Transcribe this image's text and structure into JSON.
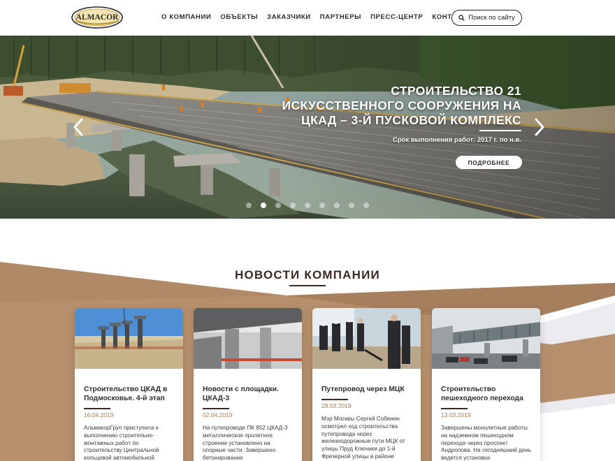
{
  "header": {
    "logo_text": "ALMACOR",
    "nav": [
      "О КОМПАНИИ",
      "ОБЪЕКТЫ",
      "ЗАКАЗЧИКИ",
      "ПАРТНЕРЫ",
      "ПРЕСС-ЦЕНТР",
      "КОНТАКТЫ"
    ],
    "search_label": "Поиск по сайту",
    "search_icon": "search-icon"
  },
  "hero": {
    "title": "СТРОИТЕЛЬСТВО 21 ИСКУССТВЕННОГО СООРУЖЕНИЯ НА ЦКАД – 3-Й ПУСКОВОЙ КОМПЛЕКС",
    "subtitle": "Срок выполнения работ: 2017 г. по н.в.",
    "more_label": "ПОДРОБНЕЕ",
    "slide_count": 9,
    "active_slide": 2
  },
  "news": {
    "title": "НОВОСТИ КОМПАНИИ",
    "items": [
      {
        "title": "Строительство ЦКАД в Подмосковье. 4-й этап",
        "date": "16.04.2019",
        "text": "АльмакорГруп приступила к выполнению строительно-монтажных работ по строительству Центральной кольцевой автомобильной"
      },
      {
        "title": "Новости с площадки. ЦКАД-3",
        "date": "02.04.2019",
        "text": "На путепроводе ПК 852 ЦКАД-3 металлическое пролетное строение установлено на опорные части. Завершено бетонирование"
      },
      {
        "title": "Путепровод через МЦК",
        "date": "28.03.2019",
        "text": "Мэр Москвы Сергей Собянин осмотрел ход строительства путепровода через железнодорожные пути МЦК от улицы Пруд Ключики до 1-й Фрезерной улицы в районе"
      },
      {
        "title": "Строительство пешеходного перехода",
        "date": "13.03.2019",
        "text": "Завершены монолитные работы на надземном пешеходном переходе через проспект Андропова. На сегодняшний день ведется установка"
      }
    ]
  },
  "colors": {
    "accent_brown": "#b6906d",
    "dark_brown": "#3b2a22",
    "date_color": "#b07a4e"
  }
}
